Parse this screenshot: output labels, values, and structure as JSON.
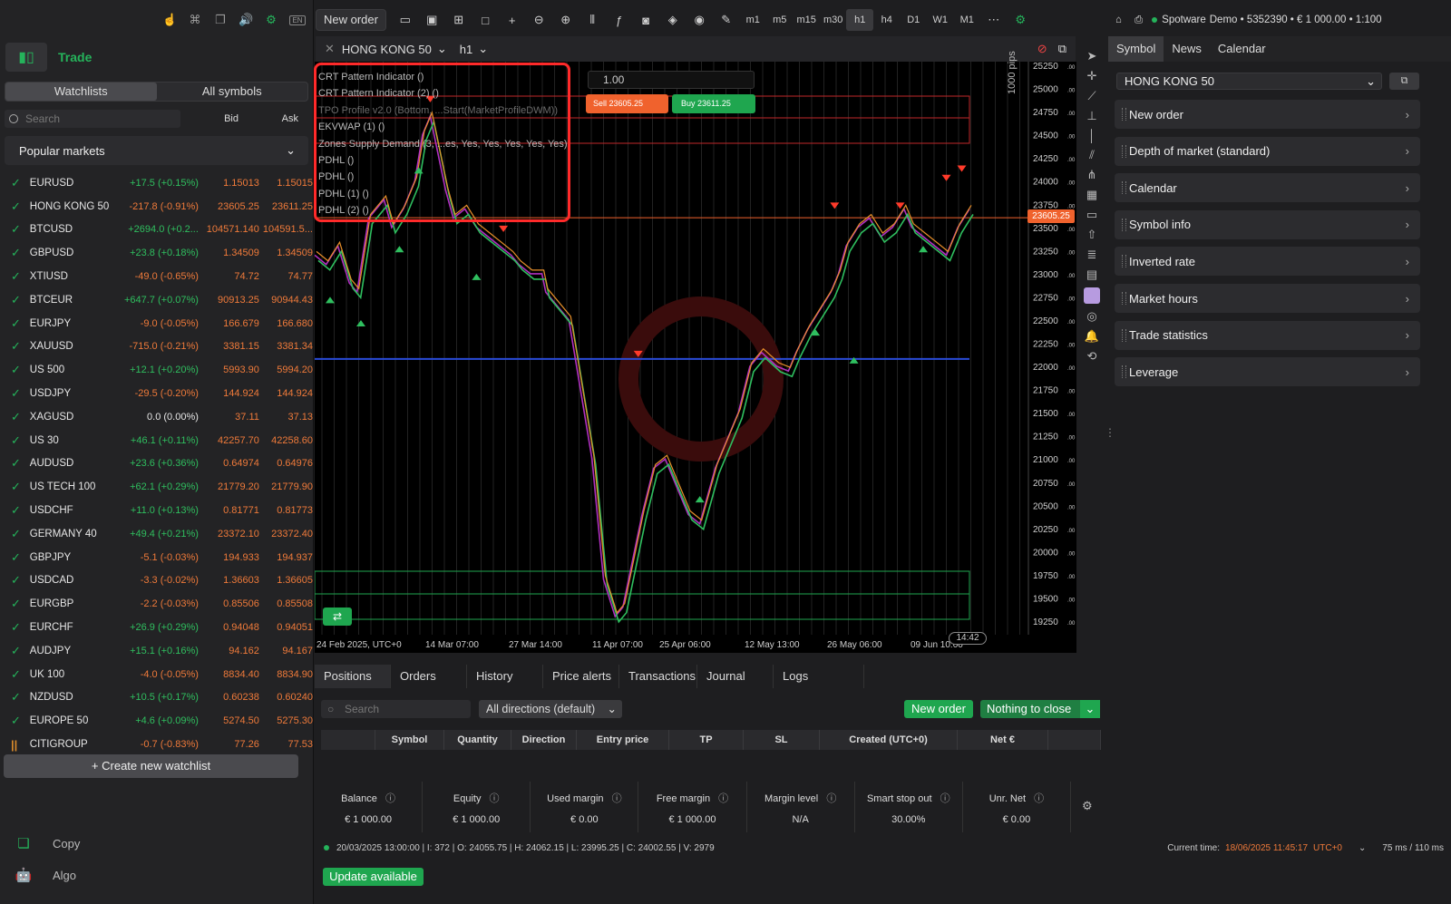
{
  "left_top_icons": [
    "hand-icon",
    "command-icon",
    "windows-icon",
    "sound-icon",
    "bot-icon",
    "keyboard-lang-icon"
  ],
  "left_top_lang": "EN",
  "trade": {
    "label": "Trade"
  },
  "watchlist_tabs": [
    "Watchlists",
    "All symbols"
  ],
  "search": {
    "placeholder": "Search",
    "bid": "Bid",
    "ask": "Ask"
  },
  "popular": "Popular markets",
  "symbols": [
    {
      "sym": "EURUSD",
      "chg": "+17.5 (+0.15%)",
      "dir": "pos",
      "bid": "1.15013",
      "ask": "1.15015"
    },
    {
      "sym": "HONG KONG 50",
      "chg": "-217.8 (-0.91%)",
      "dir": "neg",
      "bid": "23605.25",
      "ask": "23611.25"
    },
    {
      "sym": "BTCUSD",
      "chg": "+2694.0 (+0.2...",
      "dir": "pos",
      "bid": "104571.140",
      "ask": "104591.5..."
    },
    {
      "sym": "GBPUSD",
      "chg": "+23.8 (+0.18%)",
      "dir": "pos",
      "bid": "1.34509",
      "ask": "1.34509"
    },
    {
      "sym": "XTIUSD",
      "chg": "-49.0 (-0.65%)",
      "dir": "neg",
      "bid": "74.72",
      "ask": "74.77"
    },
    {
      "sym": "BTCEUR",
      "chg": "+647.7 (+0.07%)",
      "dir": "pos",
      "bid": "90913.25",
      "ask": "90944.43"
    },
    {
      "sym": "EURJPY",
      "chg": "-9.0 (-0.05%)",
      "dir": "neg",
      "bid": "166.679",
      "ask": "166.680"
    },
    {
      "sym": "XAUUSD",
      "chg": "-715.0 (-0.21%)",
      "dir": "neg",
      "bid": "3381.15",
      "ask": "3381.34"
    },
    {
      "sym": "US 500",
      "chg": "+12.1 (+0.20%)",
      "dir": "pos",
      "bid": "5993.90",
      "ask": "5994.20"
    },
    {
      "sym": "USDJPY",
      "chg": "-29.5 (-0.20%)",
      "dir": "neg",
      "bid": "144.924",
      "ask": "144.924"
    },
    {
      "sym": "XAGUSD",
      "chg": "0.0 (0.00%)",
      "dir": "zero",
      "bid": "37.11",
      "ask": "37.13"
    },
    {
      "sym": "US 30",
      "chg": "+46.1 (+0.11%)",
      "dir": "pos",
      "bid": "42257.70",
      "ask": "42258.60"
    },
    {
      "sym": "AUDUSD",
      "chg": "+23.6 (+0.36%)",
      "dir": "pos",
      "bid": "0.64974",
      "ask": "0.64976"
    },
    {
      "sym": "US TECH 100",
      "chg": "+62.1 (+0.29%)",
      "dir": "pos",
      "bid": "21779.20",
      "ask": "21779.90"
    },
    {
      "sym": "USDCHF",
      "chg": "+11.0 (+0.13%)",
      "dir": "pos",
      "bid": "0.81771",
      "ask": "0.81773"
    },
    {
      "sym": "GERMANY 40",
      "chg": "+49.4 (+0.21%)",
      "dir": "pos",
      "bid": "23372.10",
      "ask": "23372.40"
    },
    {
      "sym": "GBPJPY",
      "chg": "-5.1 (-0.03%)",
      "dir": "neg",
      "bid": "194.933",
      "ask": "194.937"
    },
    {
      "sym": "USDCAD",
      "chg": "-3.3 (-0.02%)",
      "dir": "neg",
      "bid": "1.36603",
      "ask": "1.36605"
    },
    {
      "sym": "EURGBP",
      "chg": "-2.2 (-0.03%)",
      "dir": "neg",
      "bid": "0.85506",
      "ask": "0.85508"
    },
    {
      "sym": "EURCHF",
      "chg": "+26.9 (+0.29%)",
      "dir": "pos",
      "bid": "0.94048",
      "ask": "0.94051"
    },
    {
      "sym": "AUDJPY",
      "chg": "+15.1 (+0.16%)",
      "dir": "pos",
      "bid": "94.162",
      "ask": "94.167"
    },
    {
      "sym": "UK 100",
      "chg": "-4.0 (-0.05%)",
      "dir": "neg",
      "bid": "8834.40",
      "ask": "8834.90"
    },
    {
      "sym": "NZDUSD",
      "chg": "+10.5 (+0.17%)",
      "dir": "pos",
      "bid": "0.60238",
      "ask": "0.60240"
    },
    {
      "sym": "EUROPE 50",
      "chg": "+4.6 (+0.09%)",
      "dir": "pos",
      "bid": "5274.50",
      "ask": "5275.30"
    },
    {
      "sym": "CITIGROUP",
      "chg": "-0.7 (-0.83%)",
      "dir": "neg",
      "bid": "77.26",
      "ask": "77.53",
      "paused": true
    }
  ],
  "create_watchlist": "Create new watchlist",
  "left_nav": {
    "copy": "Copy",
    "algo": "Algo"
  },
  "toolbar": {
    "new_order": "New order",
    "timeframes": [
      "m1",
      "m5",
      "m15",
      "m30",
      "h1",
      "h4",
      "D1",
      "W1",
      "M1"
    ],
    "selected_tf": "h1"
  },
  "account": {
    "broker": "Spotware",
    "info": "Demo • 5352390 • € 1 000.00 • 1:100"
  },
  "chart_tab": {
    "symbol": "HONG KONG 50",
    "timeframe": "h1"
  },
  "indicators": [
    "CRT Pattern Indicator ()",
    "CRT Pattern Indicator (2) ()",
    "TPO Profile v2.0 (Bottom, ...Start(MarketProfileDWM))",
    "EKVWAP (1) ()",
    "Zones Supply Demand (3, ...es, Yes, Yes, Yes, Yes, Yes)",
    "PDHL ()",
    "PDHL ()",
    "PDHL (1) ()",
    "PDHL (2) ()"
  ],
  "trade_panel": {
    "qty": "1.00",
    "sell": "Sell 23605.25",
    "buy": "Buy 23611.25"
  },
  "pips_label": "1000 pips",
  "current_price": "23605.25",
  "current_time_label": "14:42",
  "y_ticks": [
    "25250.00",
    "25000.00",
    "24750.00",
    "24500.00",
    "24250.00",
    "24000.00",
    "23750.00",
    "23500.00",
    "23250.00",
    "23000.00",
    "22750.00",
    "22500.00",
    "22250.00",
    "22000.00",
    "21750.00",
    "21500.00",
    "21250.00",
    "21000.00",
    "20750.00",
    "20500.00",
    "20250.00",
    "20000.00",
    "19750.00",
    "19500.00",
    "19250.00"
  ],
  "x_ticks": [
    "24 Feb 2025, UTC+0",
    "14 Mar 07:00",
    "27 Mar 14:00",
    "11 Apr 07:00",
    "25 Apr 06:00",
    "12 May 13:00",
    "26 May 06:00",
    "09 Jun 10:00"
  ],
  "bottom_tabs": [
    "Positions",
    "Orders",
    "History",
    "Price alerts",
    "Transactions",
    "Journal",
    "Logs"
  ],
  "bottom": {
    "search_placeholder": "Search",
    "direction": "All directions (default)",
    "new_order": "New order",
    "nothing_to_close": "Nothing to close",
    "columns": [
      "",
      "Symbol",
      "Quantity",
      "Direction",
      "Entry price",
      "TP",
      "SL",
      "Created (UTC+0)",
      "Net €"
    ]
  },
  "stats": [
    {
      "label": "Balance",
      "value": "€ 1 000.00"
    },
    {
      "label": "Equity",
      "value": "€ 1 000.00"
    },
    {
      "label": "Used margin",
      "value": "€ 0.00"
    },
    {
      "label": "Free margin",
      "value": "€ 1 000.00"
    },
    {
      "label": "Margin level",
      "value": "N/A"
    },
    {
      "label": "Smart stop out",
      "value": "30.00%"
    },
    {
      "label": "Unr. Net",
      "value": "€ 0.00"
    }
  ],
  "status_bar": {
    "ohlc": "20/03/2025 13:00:00 | I: 372 | O: 24055.75 | H: 24062.15 | L: 23995.25 | C: 24002.55 | V: 2979",
    "current_time_label": "Current time:",
    "current_time": "18/06/2025 11:45:17",
    "tz": "UTC+0",
    "latency": "75 ms / 110 ms"
  },
  "update_available": "Update available",
  "right_tabs": [
    "Symbol",
    "News",
    "Calendar"
  ],
  "right_symbol": "HONG KONG 50",
  "right_menu": [
    "New order",
    "Depth of market (standard)",
    "Calendar",
    "Symbol info",
    "Inverted rate",
    "Market hours",
    "Trade statistics",
    "Leverage"
  ],
  "colors": {
    "accent": "#25b35b",
    "sell": "#f0622d",
    "buy": "#1fa64f",
    "highlight_box": "#ff2a2a"
  }
}
